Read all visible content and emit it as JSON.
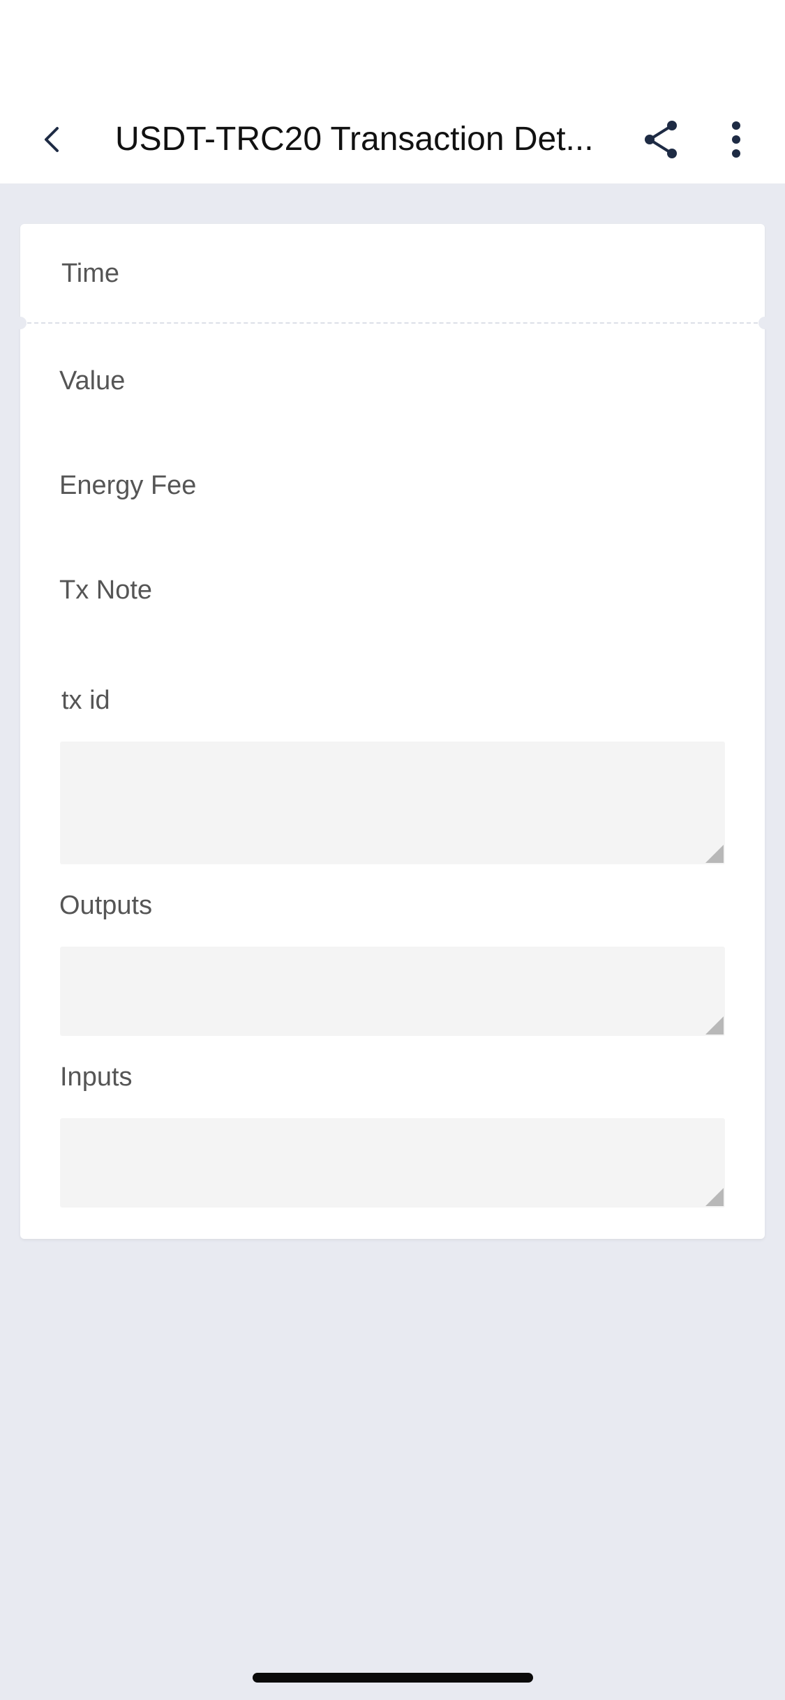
{
  "header": {
    "title": "USDT-TRC20 Transaction Det...",
    "back_icon": "chevron-left-icon",
    "share_icon": "share-icon",
    "more_icon": "more-vertical-icon",
    "icon_color": "#1e2b44"
  },
  "details": {
    "time_label": "Time",
    "value_label": "Value",
    "energy_fee_label": "Energy Fee",
    "tx_note_label": "Tx Note",
    "tx_id_label": "tx id",
    "tx_id_value": "",
    "outputs_label": "Outputs",
    "outputs_value": "",
    "inputs_label": "Inputs",
    "inputs_value": ""
  },
  "colors": {
    "background": "#e8eaf1",
    "card": "#ffffff",
    "field": "#f4f4f4",
    "label_text": "#555555"
  }
}
